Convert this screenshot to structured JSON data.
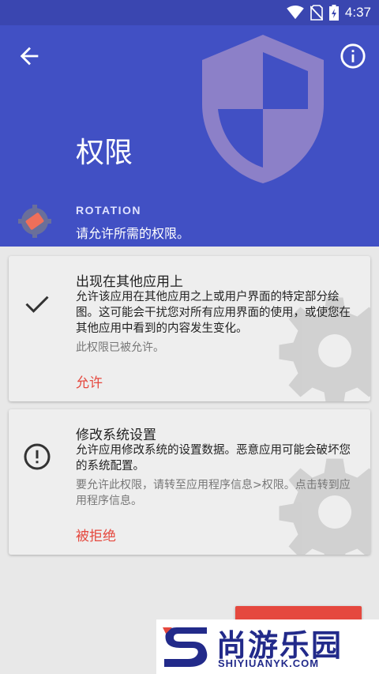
{
  "status_bar": {
    "time": "4:37",
    "icons": [
      "wifi-icon",
      "no-sim-icon",
      "battery-charging-icon"
    ]
  },
  "header": {
    "title": "权限",
    "app_name": "ROTATION",
    "subtitle": "请允许所需的权限。",
    "back_icon": "arrow-back-icon",
    "info_icon": "info-icon",
    "shield_icon": "shield-icon",
    "colors": {
      "primary": "#4150c4",
      "status_bar": "#3a46b0",
      "accent": "#e5483e"
    }
  },
  "permissions": [
    {
      "title": "出现在其他应用上",
      "description": "允许该应用在其他应用之上或用户界面的特定部分绘图。这可能会干扰您对所有应用界面的使用，或使您在其他应用中看到的内容发生变化。",
      "note": "此权限已被允许。",
      "action": "允许",
      "state_icon": "checkmark-icon"
    },
    {
      "title": "修改系统设置",
      "description": "允许应用修改系统的设置数据。恶意应用可能会破坏您的系统配置。",
      "note": "要允许此权限，请转至应用程序信息>权限。点击转到应用程序信息。",
      "action": "被拒绝",
      "state_icon": "alert-circle-icon"
    }
  ],
  "watermark": {
    "text": "尚游乐园",
    "sub": "SHIYIUANYK.COM"
  }
}
